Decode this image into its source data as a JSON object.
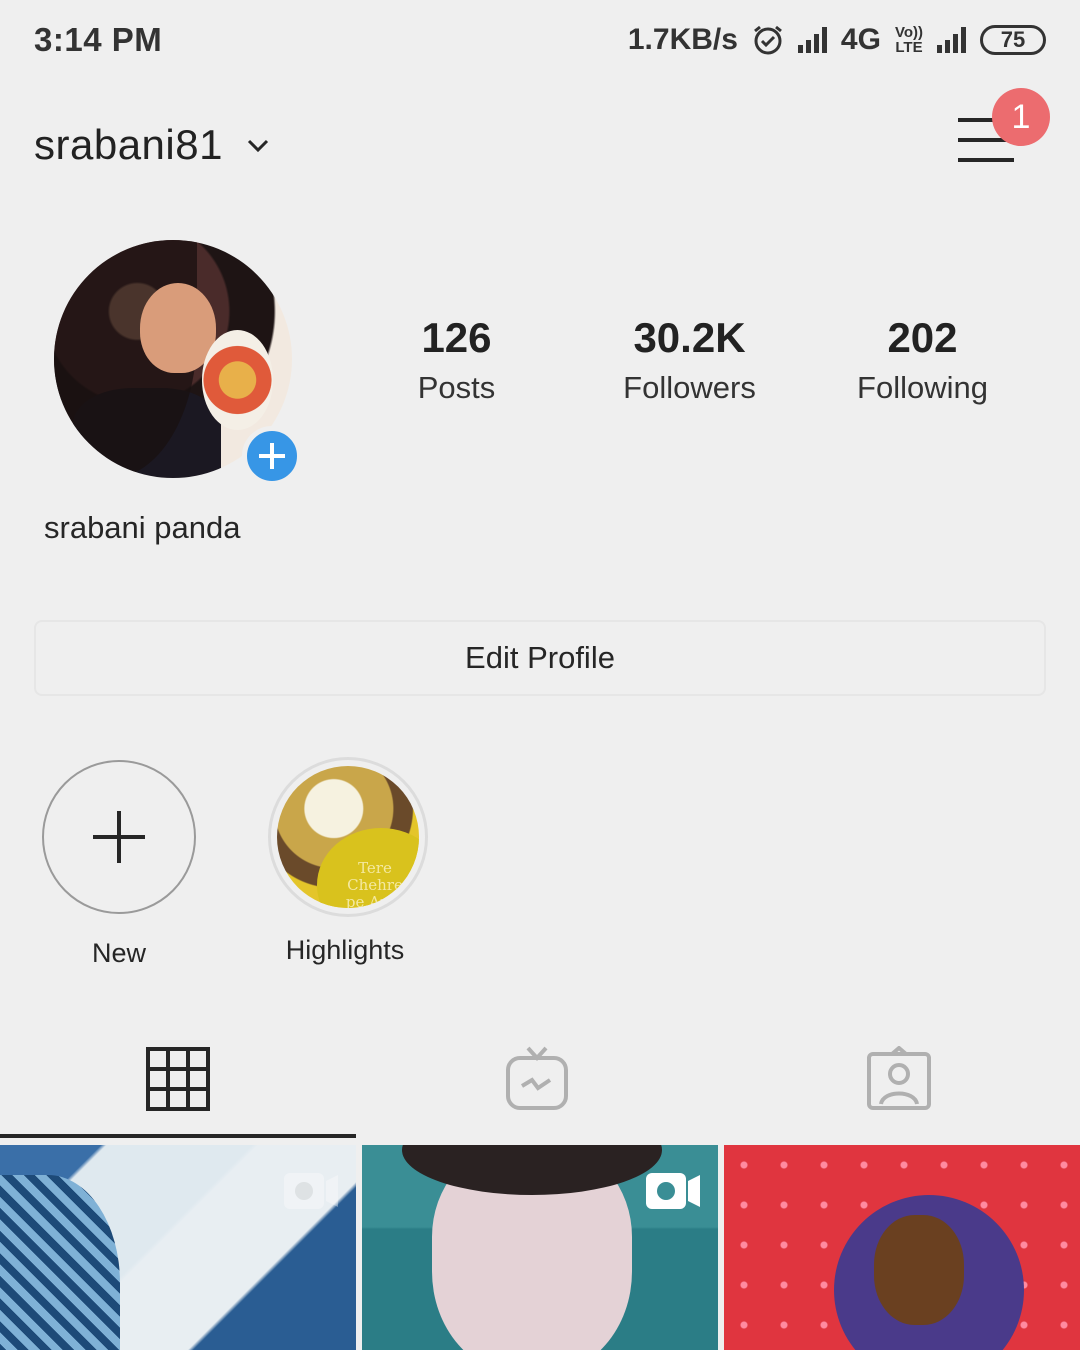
{
  "status_bar": {
    "time": "3:14 PM",
    "net_speed": "1.7KB/s",
    "network": "4G",
    "volte_top": "Vo))",
    "volte_bottom": "LTE",
    "battery": "75"
  },
  "header": {
    "username": "srabani81",
    "notification_count": "1"
  },
  "profile": {
    "full_name": "srabani panda",
    "stats": [
      {
        "value": "126",
        "label": "Posts"
      },
      {
        "value": "30.2K",
        "label": "Followers"
      },
      {
        "value": "202",
        "label": "Following"
      }
    ],
    "edit_profile_label": "Edit Profile"
  },
  "highlights": {
    "new_label": "New",
    "items": [
      {
        "label": "Highlights",
        "thumb_text_1": "Tere Chehre",
        "thumb_text_2": "pe Apni"
      }
    ]
  },
  "tabs": [
    {
      "icon": "grid-icon",
      "active": true
    },
    {
      "icon": "igtv-icon",
      "active": false
    },
    {
      "icon": "tagged-icon",
      "active": false
    }
  ],
  "colors": {
    "background": "#efefef",
    "badge": "#ec6c6f",
    "add_story": "#3796e6",
    "text": "#262626"
  }
}
